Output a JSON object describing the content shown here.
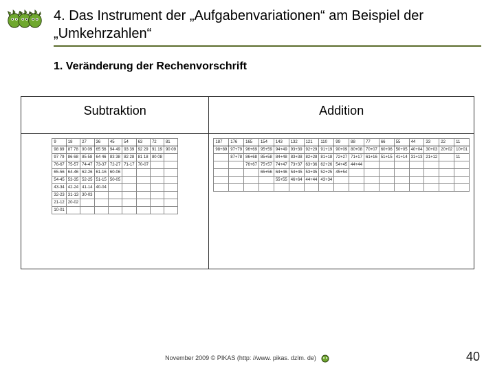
{
  "title": "4. Das Instrument der „Aufgabenvariationen“ am Beispiel der „Umkehrzahlen“",
  "subtitle": "1. Veränderung der Rechenvorschrift",
  "left": {
    "heading": "Subtraktion",
    "header_row": [
      "9",
      "18",
      "27",
      "36",
      "45",
      "54",
      "63",
      "72",
      "81"
    ],
    "rows": [
      [
        "98 89",
        "87 78",
        "90 09",
        "65 56",
        "94 49",
        "93 39",
        "92 29",
        "91 19",
        "90 09"
      ],
      [
        "97 79",
        "86 68",
        "85 58",
        "64 46",
        "83 38",
        "82 28",
        "81 18",
        "80 08",
        ""
      ],
      [
        "76-67",
        "75-57",
        "74-47",
        "73-37",
        "72-27",
        "71-17",
        "70-07",
        "",
        ""
      ],
      [
        "65-56",
        "64-46",
        "62-26",
        "61-16",
        "60-06",
        "",
        "",
        "",
        ""
      ],
      [
        "54-45",
        "53-35",
        "52-25",
        "51-15",
        "50-05",
        "",
        "",
        "",
        ""
      ],
      [
        "43-34",
        "42-24",
        "41-14",
        "40-04",
        "",
        "",
        "",
        "",
        ""
      ],
      [
        "32-23",
        "31-13",
        "30-03",
        "",
        "",
        "",
        "",
        "",
        ""
      ],
      [
        "21-12",
        "20-02",
        "",
        "",
        "",
        "",
        "",
        "",
        ""
      ],
      [
        "10-01",
        "",
        "",
        "",
        "",
        "",
        "",
        "",
        ""
      ]
    ]
  },
  "right": {
    "heading": "Addition",
    "header_row": [
      "187",
      "176",
      "165",
      "154",
      "143",
      "132",
      "121",
      "110",
      "99",
      "88",
      "77",
      "66",
      "55",
      "44",
      "33",
      "22",
      "11"
    ],
    "rows": [
      [
        "98+89",
        "97+79",
        "96+69",
        "95+59",
        "94+49",
        "93+39",
        "92+29",
        "91+19",
        "90+09",
        "80+08",
        "70+07",
        "60+06",
        "50+05",
        "40+04",
        "30+03",
        "20+02",
        "10+01"
      ],
      [
        "",
        "87+78",
        "86+68",
        "85+58",
        "84+48",
        "83+38",
        "82+28",
        "81+18",
        "72+27",
        "71+17",
        "61+16",
        "51+15",
        "41+14",
        "31+13",
        "21+12",
        "",
        "11"
      ],
      [
        "",
        "",
        "76+67",
        "75+57",
        "74+47",
        "73+37",
        "63+36",
        "62+26",
        "54+45",
        "44+44",
        "",
        "",
        "",
        "",
        "",
        "",
        ""
      ],
      [
        "",
        "",
        "",
        "65+56",
        "64+46",
        "54+45",
        "53+35",
        "52+25",
        "45+54",
        "",
        "",
        "",
        "",
        "",
        "",
        "",
        ""
      ],
      [
        "",
        "",
        "",
        "",
        "55+55",
        "46+64",
        "44+44",
        "43+34",
        "",
        "",
        "",
        "",
        "",
        "",
        "",
        "",
        ""
      ],
      [
        "",
        "",
        "",
        "",
        "",
        "",
        "",
        "",
        "",
        "",
        "",
        "",
        "",
        "",
        "",
        "",
        ""
      ]
    ]
  },
  "footer": "November 2009 © PIKAS (http: //www. pikas. dzlm. de)",
  "page": "40"
}
